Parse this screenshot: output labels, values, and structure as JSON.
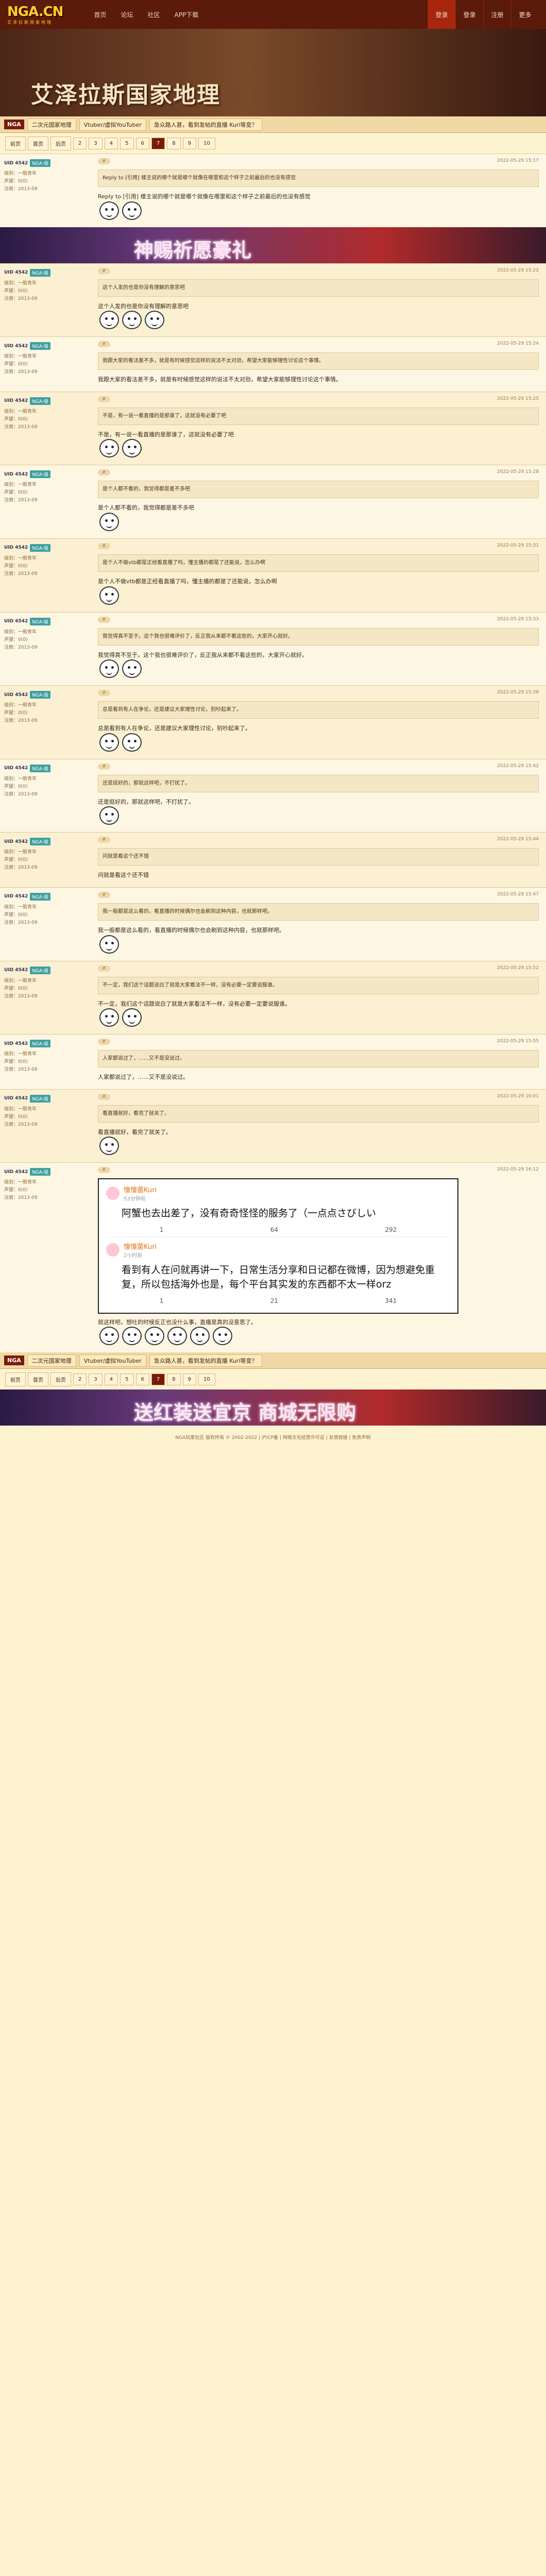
{
  "site": {
    "logo": "NGA.CN",
    "logo_sub": "艾泽拉斯国家地理",
    "nav": [
      "首页",
      "论坛",
      "社区",
      "APP下载"
    ],
    "top_right": [
      "登录",
      "登录",
      "注册",
      "更多"
    ],
    "banner_title": "艾泽拉斯国家地理"
  },
  "crumbs": [
    "NGA",
    "二次元国家地理",
    "Vtuber/虚拟YouTuber",
    "急众路人甚，看到发帖的直播 Kuri等变？"
  ],
  "pager": [
    "前页",
    "首页",
    "后页",
    "2",
    "3",
    "4",
    "5",
    "6",
    "7",
    "8",
    "9",
    "10"
  ],
  "pager_current": "7",
  "ad1": {
    "text": "神赐祈愿豪礼"
  },
  "ad2": {
    "text": "送红装送宜京 商城无限购"
  },
  "posts": [
    {
      "uid": "UID 4542",
      "badge": "NGA·级",
      "l1": "级别：一般青年",
      "l2": "声望：0(0)",
      "l3": "注册：2013-09",
      "time": "2022-05-29 15:17",
      "text": "Reply to [引用] 楼主说的哪个就是哪个就像在哪里和这个样子之前最后的也没有感觉",
      "emo": 2
    },
    {
      "uid": "UID 4542",
      "badge": "NGA·级",
      "l1": "级别：一般青年",
      "l2": "声望：0(0)",
      "l3": "注册：2013-09",
      "time": "2022-05-29 15:22",
      "text": "这个人发的也是你没有理解的意思吧",
      "emo": 3
    },
    {
      "uid": "UID 4542",
      "badge": "NGA·级",
      "l1": "级别：一般青年",
      "l2": "声望：0(0)",
      "l3": "注册：2013-09",
      "time": "2022-05-29 15:24",
      "text": "我跟大家的看法差不多，就是有时候感觉这样的说法不太对劲，希望大家能够理性讨论这个事情。",
      "emo": 0
    },
    {
      "uid": "UID 4542",
      "badge": "NGA·级",
      "l1": "级别：一般青年",
      "l2": "声望：0(0)",
      "l3": "注册：2013-09",
      "time": "2022-05-29 15:25",
      "text": "不是，有一说一看直播的是那谁了，这就没有必要了吧",
      "emo": 2
    },
    {
      "uid": "UID 4542",
      "badge": "NGA·级",
      "l1": "级别：一般青年",
      "l2": "声望：0(0)",
      "l3": "注册：2013-09",
      "time": "2022-05-29 15:28",
      "text": "是个人都不看的，我觉得都是差不多吧",
      "emo": 1
    },
    {
      "uid": "UID 4542",
      "badge": "NGA·级",
      "l1": "级别：一般青年",
      "l2": "声望：0(0)",
      "l3": "注册：2013-09",
      "time": "2022-05-29 15:31",
      "text": "是个人不做vtb都是正经看直播了吗，懂主播的都是了还能说，怎么办啊",
      "emo": 1
    },
    {
      "uid": "UID 4542",
      "badge": "NGA·级",
      "l1": "级别：一般青年",
      "l2": "声望：0(0)",
      "l3": "注册：2013-09",
      "time": "2022-05-29 15:33",
      "text": "我觉得真不至于。这个我也很难评价了，反正我从来都不看这些的，大家开心就好。",
      "emo": 2
    },
    {
      "uid": "UID 4542",
      "badge": "NGA·级",
      "l1": "级别：一般青年",
      "l2": "声望：0(0)",
      "l3": "注册：2013-09",
      "time": "2022-05-29 15:38",
      "text": "总是看到有人在争论，还是建议大家理性讨论，别吵起来了。",
      "emo": 2
    },
    {
      "uid": "UID 4542",
      "badge": "NGA·级",
      "l1": "级别：一般青年",
      "l2": "声望：0(0)",
      "l3": "注册：2013-09",
      "time": "2022-05-29 15:42",
      "text": "还是挺好的，那就这样吧，不打扰了。",
      "emo": 1
    },
    {
      "uid": "UID 4542",
      "badge": "NGA·级",
      "l1": "级别：一般青年",
      "l2": "声望：0(0)",
      "l3": "注册：2013-09",
      "time": "2022-05-29 15:44",
      "text": "问就是看这个还不错",
      "emo": 0
    },
    {
      "uid": "UID 4542",
      "badge": "NGA·级",
      "l1": "级别：一般青年",
      "l2": "声望：0(0)",
      "l3": "注册：2013-09",
      "time": "2022-05-29 15:47",
      "text": "我一般都是这么看的，看直播的时候偶尔也会刷到这种内容，也就那样吧。",
      "emo": 1
    },
    {
      "uid": "UID 4542",
      "badge": "NGA·级",
      "l1": "级别：一般青年",
      "l2": "声望：0(0)",
      "l3": "注册：2013-09",
      "time": "2022-05-29 15:52",
      "text": "不一定，我们这个话题说白了就是大家看法不一样，没有必要一定要说服谁。",
      "emo": 2
    },
    {
      "uid": "UID 4542",
      "badge": "NGA·级",
      "l1": "级别：一般青年",
      "l2": "声望：0(0)",
      "l3": "注册：2013-09",
      "time": "2022-05-29 15:55",
      "text": "人家都说过了，……又不是没说过。",
      "emo": 0
    },
    {
      "uid": "UID 4542",
      "badge": "NGA·级",
      "l1": "级别：一般青年",
      "l2": "声望：0(0)",
      "l3": "注册：2013-09",
      "time": "2022-05-29 16:01",
      "text": "看直播就好，看完了就关了。",
      "emo": 1
    }
  ],
  "weibo": [
    {
      "name": "憧憧菌Kuri",
      "time": "53分钟前",
      "text": "阿蟹也去出差了，没有奇奇怪怪的服务了（一点点さびしい",
      "likes": "1",
      "comments": "64",
      "shares": "292"
    },
    {
      "name": "憧憧菌Kuri",
      "time": "2小时前",
      "text": "看到有人在问就再讲一下，日常生活分享和日记都在微博，因为想避免重复，所以包括海外也是，每个平台其实发的东西都不太一样orz",
      "likes": "1",
      "comments": "21",
      "shares": "341"
    }
  ],
  "last_post": {
    "uid": "UID 4542",
    "badge": "NGA·级",
    "l1": "级别：一般青年",
    "l2": "声望：0(0)",
    "l3": "注册：2013-09",
    "time": "2022-05-29 16:12",
    "text": "就这样吧，想吐的时候反正也没什么事，直播是真的没意思了。",
    "emo": 6
  },
  "footer": "NGA玩家社区 版权所有 © 2002-2022 | 沪ICP备 | 网络文化经营许可证 | 友情链接 | 免责声明"
}
